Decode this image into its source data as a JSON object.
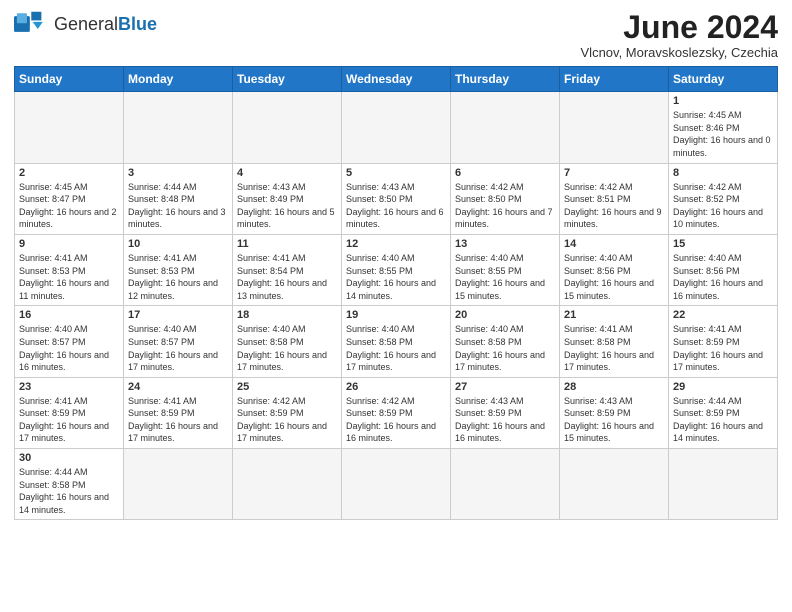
{
  "header": {
    "logo_general": "General",
    "logo_blue": "Blue",
    "month_title": "June 2024",
    "subtitle": "Vlcnov, Moravskoslezsky, Czechia"
  },
  "weekdays": [
    "Sunday",
    "Monday",
    "Tuesday",
    "Wednesday",
    "Thursday",
    "Friday",
    "Saturday"
  ],
  "weeks": [
    [
      {
        "day": null,
        "info": null
      },
      {
        "day": null,
        "info": null
      },
      {
        "day": null,
        "info": null
      },
      {
        "day": null,
        "info": null
      },
      {
        "day": null,
        "info": null
      },
      {
        "day": null,
        "info": null
      },
      {
        "day": "1",
        "info": "Sunrise: 4:45 AM\nSunset: 8:46 PM\nDaylight: 16 hours\nand 0 minutes."
      }
    ],
    [
      {
        "day": "2",
        "info": "Sunrise: 4:45 AM\nSunset: 8:47 PM\nDaylight: 16 hours\nand 2 minutes."
      },
      {
        "day": "3",
        "info": "Sunrise: 4:44 AM\nSunset: 8:48 PM\nDaylight: 16 hours\nand 3 minutes."
      },
      {
        "day": "4",
        "info": "Sunrise: 4:43 AM\nSunset: 8:49 PM\nDaylight: 16 hours\nand 5 minutes."
      },
      {
        "day": "5",
        "info": "Sunrise: 4:43 AM\nSunset: 8:50 PM\nDaylight: 16 hours\nand 6 minutes."
      },
      {
        "day": "6",
        "info": "Sunrise: 4:42 AM\nSunset: 8:50 PM\nDaylight: 16 hours\nand 7 minutes."
      },
      {
        "day": "7",
        "info": "Sunrise: 4:42 AM\nSunset: 8:51 PM\nDaylight: 16 hours\nand 9 minutes."
      },
      {
        "day": "8",
        "info": "Sunrise: 4:42 AM\nSunset: 8:52 PM\nDaylight: 16 hours\nand 10 minutes."
      }
    ],
    [
      {
        "day": "9",
        "info": "Sunrise: 4:41 AM\nSunset: 8:53 PM\nDaylight: 16 hours\nand 11 minutes."
      },
      {
        "day": "10",
        "info": "Sunrise: 4:41 AM\nSunset: 8:53 PM\nDaylight: 16 hours\nand 12 minutes."
      },
      {
        "day": "11",
        "info": "Sunrise: 4:41 AM\nSunset: 8:54 PM\nDaylight: 16 hours\nand 13 minutes."
      },
      {
        "day": "12",
        "info": "Sunrise: 4:40 AM\nSunset: 8:55 PM\nDaylight: 16 hours\nand 14 minutes."
      },
      {
        "day": "13",
        "info": "Sunrise: 4:40 AM\nSunset: 8:55 PM\nDaylight: 16 hours\nand 15 minutes."
      },
      {
        "day": "14",
        "info": "Sunrise: 4:40 AM\nSunset: 8:56 PM\nDaylight: 16 hours\nand 15 minutes."
      },
      {
        "day": "15",
        "info": "Sunrise: 4:40 AM\nSunset: 8:56 PM\nDaylight: 16 hours\nand 16 minutes."
      }
    ],
    [
      {
        "day": "16",
        "info": "Sunrise: 4:40 AM\nSunset: 8:57 PM\nDaylight: 16 hours\nand 16 minutes."
      },
      {
        "day": "17",
        "info": "Sunrise: 4:40 AM\nSunset: 8:57 PM\nDaylight: 16 hours\nand 17 minutes."
      },
      {
        "day": "18",
        "info": "Sunrise: 4:40 AM\nSunset: 8:58 PM\nDaylight: 16 hours\nand 17 minutes."
      },
      {
        "day": "19",
        "info": "Sunrise: 4:40 AM\nSunset: 8:58 PM\nDaylight: 16 hours\nand 17 minutes."
      },
      {
        "day": "20",
        "info": "Sunrise: 4:40 AM\nSunset: 8:58 PM\nDaylight: 16 hours\nand 17 minutes."
      },
      {
        "day": "21",
        "info": "Sunrise: 4:41 AM\nSunset: 8:58 PM\nDaylight: 16 hours\nand 17 minutes."
      },
      {
        "day": "22",
        "info": "Sunrise: 4:41 AM\nSunset: 8:59 PM\nDaylight: 16 hours\nand 17 minutes."
      }
    ],
    [
      {
        "day": "23",
        "info": "Sunrise: 4:41 AM\nSunset: 8:59 PM\nDaylight: 16 hours\nand 17 minutes."
      },
      {
        "day": "24",
        "info": "Sunrise: 4:41 AM\nSunset: 8:59 PM\nDaylight: 16 hours\nand 17 minutes."
      },
      {
        "day": "25",
        "info": "Sunrise: 4:42 AM\nSunset: 8:59 PM\nDaylight: 16 hours\nand 17 minutes."
      },
      {
        "day": "26",
        "info": "Sunrise: 4:42 AM\nSunset: 8:59 PM\nDaylight: 16 hours\nand 16 minutes."
      },
      {
        "day": "27",
        "info": "Sunrise: 4:43 AM\nSunset: 8:59 PM\nDaylight: 16 hours\nand 16 minutes."
      },
      {
        "day": "28",
        "info": "Sunrise: 4:43 AM\nSunset: 8:59 PM\nDaylight: 16 hours\nand 15 minutes."
      },
      {
        "day": "29",
        "info": "Sunrise: 4:44 AM\nSunset: 8:59 PM\nDaylight: 16 hours\nand 14 minutes."
      }
    ],
    [
      {
        "day": "30",
        "info": "Sunrise: 4:44 AM\nSunset: 8:58 PM\nDaylight: 16 hours\nand 14 minutes."
      },
      {
        "day": null,
        "info": null
      },
      {
        "day": null,
        "info": null
      },
      {
        "day": null,
        "info": null
      },
      {
        "day": null,
        "info": null
      },
      {
        "day": null,
        "info": null
      },
      {
        "day": null,
        "info": null
      }
    ]
  ]
}
